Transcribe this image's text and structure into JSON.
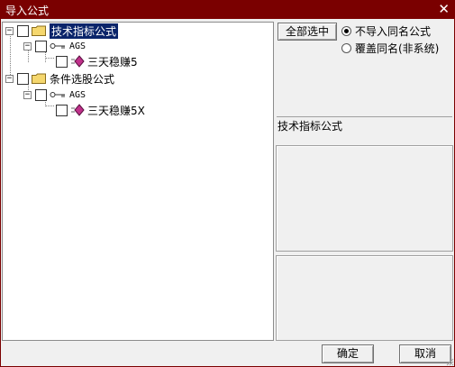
{
  "window": {
    "title": "导入公式",
    "close_glyph": "✕"
  },
  "tree": {
    "nodes": [
      {
        "label": "技术指标公式",
        "expander": "−",
        "selected": true
      },
      {
        "label": "AGS",
        "expander": "−"
      },
      {
        "label": "三天稳赚5"
      },
      {
        "label": "条件选股公式",
        "expander": "−"
      },
      {
        "label": "AGS",
        "expander": "−"
      },
      {
        "label": "三天稳赚5X"
      }
    ]
  },
  "controls": {
    "select_all": "全部选中",
    "radio_options": [
      {
        "label": "不导入同名公式",
        "checked": true
      },
      {
        "label": "覆盖同名(非系统)",
        "checked": false
      }
    ]
  },
  "info": {
    "category": "技术指标公式"
  },
  "footer": {
    "ok": "确定",
    "cancel": "取消"
  },
  "colors": {
    "titlebar": "#7a0000",
    "selection": "#0a246a",
    "folder": "#f5d76e",
    "gem": "#c0308a"
  }
}
